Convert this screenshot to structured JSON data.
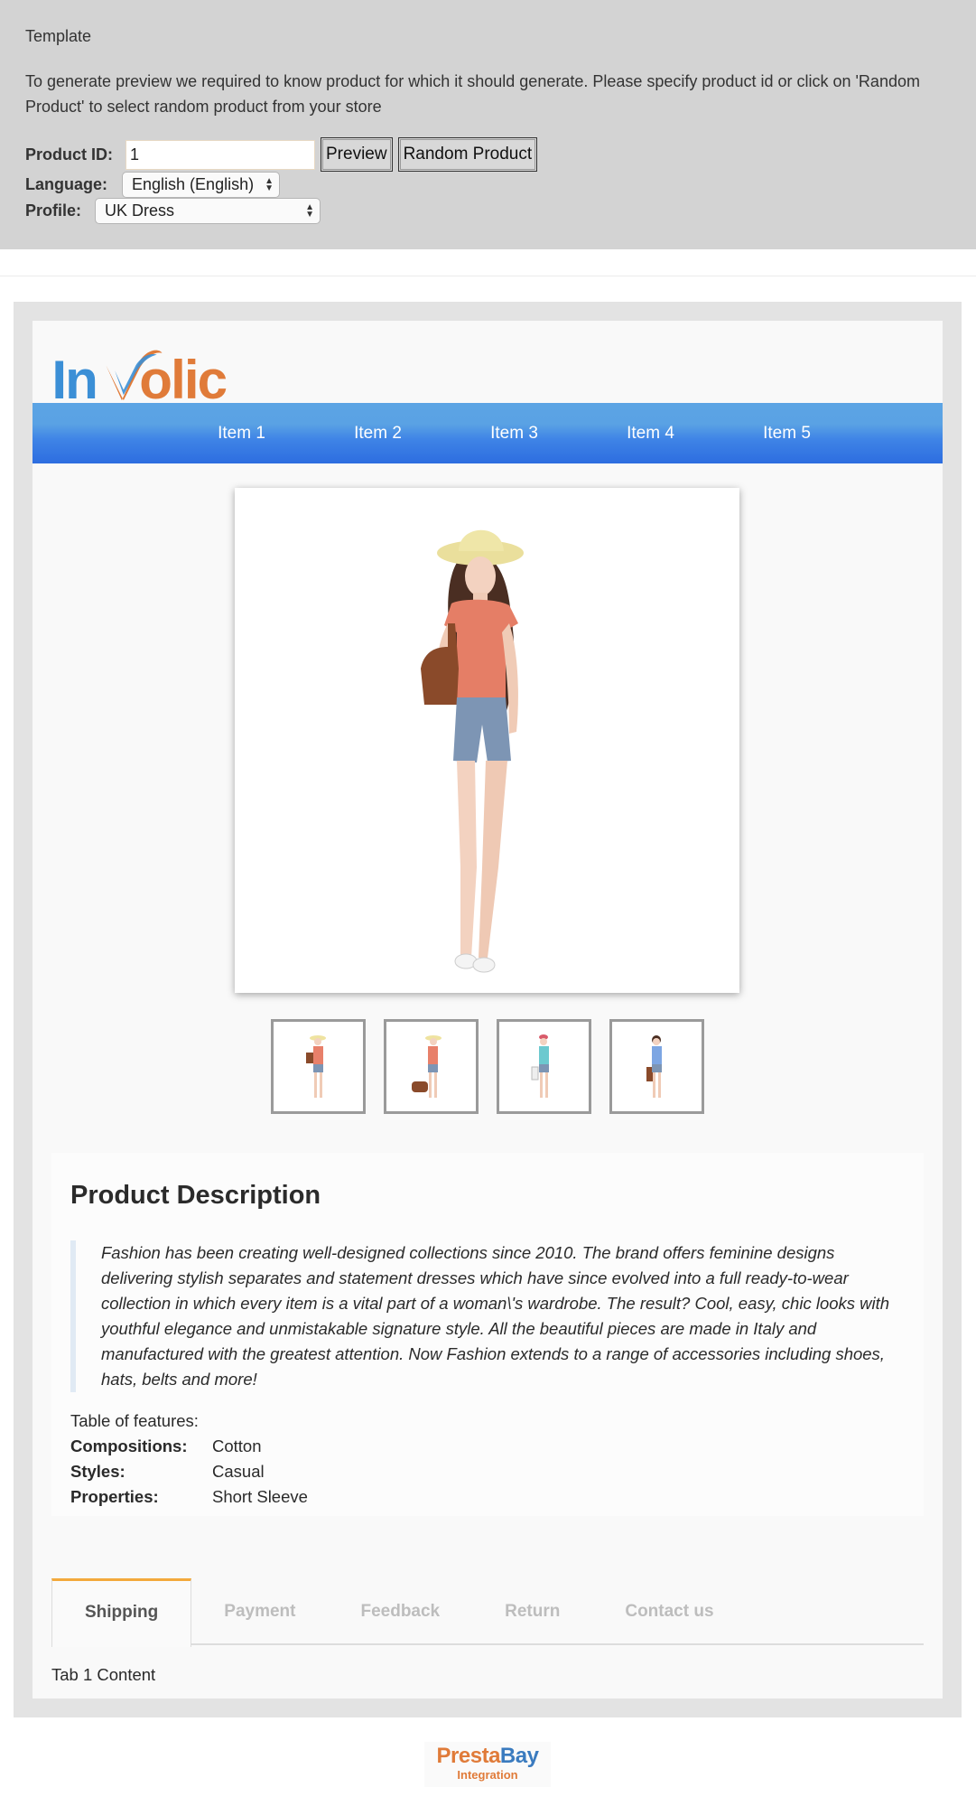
{
  "control_panel": {
    "title": "Template",
    "intro": "To generate preview we required to know product for which it should generate. Please specify product id or click on 'Random Product' to select random product from your store",
    "product_id_label": "Product ID:",
    "product_id_value": "1",
    "preview_button": "Preview",
    "random_button": "Random Product",
    "language_label": "Language:",
    "language_value": "English (English)",
    "profile_label": "Profile:",
    "profile_value": "UK Dress"
  },
  "template": {
    "logo_text": "Involic",
    "nav_items": [
      "Item 1",
      "Item 2",
      "Item 3",
      "Item 4",
      "Item 5"
    ],
    "main_image_alt": "Model in coral top, straw hat and denim shorts with brown bag",
    "thumbnails": [
      {
        "alt": "coral top with shoulder bag",
        "top_color": "#e8806a",
        "hat_color": "#efe3a0"
      },
      {
        "alt": "coral top with duffel bag",
        "top_color": "#e8806a",
        "hat_color": "#efe3a0"
      },
      {
        "alt": "turquoise top",
        "top_color": "#6cc9cf",
        "hat_color": "#d85a6a"
      },
      {
        "alt": "blue top",
        "top_color": "#7da6e3",
        "hat_color": ""
      }
    ],
    "description": {
      "title": "Product Description",
      "text": "Fashion has been creating well-designed collections since 2010. The brand offers feminine designs delivering stylish separates and statement dresses which have since evolved into a full ready-to-wear collection in which every item is a vital part of a woman\\'s wardrobe. The result? Cool, easy, chic looks with youthful elegance and unmistakable signature style. All the beautiful pieces are made in Italy and manufactured with the greatest attention. Now Fashion extends to a range of accessories including shoes, hats, belts and more!",
      "features_heading": "Table of features:",
      "features": [
        {
          "key": "Compositions:",
          "value": "Cotton"
        },
        {
          "key": "Styles:",
          "value": "Casual"
        },
        {
          "key": "Properties:",
          "value": "Short Sleeve"
        }
      ]
    },
    "tabs": [
      "Shipping",
      "Payment",
      "Feedback",
      "Return",
      "Contact us"
    ],
    "active_tab": "Shipping",
    "tab_content": "Tab 1 Content"
  },
  "footer": {
    "logo_part1": "Presta",
    "logo_part2": "Bay",
    "logo_sub": "Integration"
  },
  "colors": {
    "nav_top": "#5ca4e4",
    "nav_bottom": "#2d6de0",
    "logo_blue": "#3b8fd6",
    "logo_orange": "#e07b39",
    "active_tab_accent": "#f3a93c"
  }
}
